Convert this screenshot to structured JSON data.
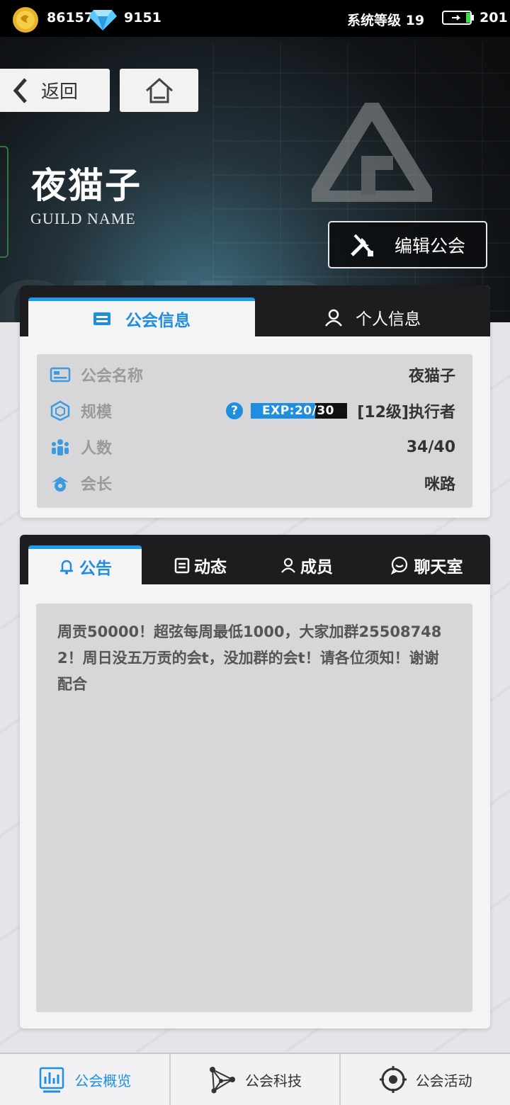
{
  "status": {
    "coins": "86157",
    "gems": "9151",
    "system_level": "系统等级 19",
    "battery": "201"
  },
  "top": {
    "back_label": "返回"
  },
  "guild": {
    "name": "夜猫子",
    "subtitle": "GUILD NAME",
    "edit_label": "编辑公会",
    "watermark": "GUILD"
  },
  "info_tabs": [
    {
      "label": "公会信息",
      "active": true
    },
    {
      "label": "个人信息",
      "active": false
    }
  ],
  "info_rows": {
    "name": {
      "label": "公会名称",
      "value": "夜猫子"
    },
    "scale": {
      "label": "规模",
      "value": "[12级]执行者",
      "exp_label": "EXP:20/30",
      "exp_current": 20,
      "exp_max": 30
    },
    "members": {
      "label": "人数",
      "value": "34/40"
    },
    "leader": {
      "label": "会长",
      "value": "咪路"
    }
  },
  "notice_tabs": [
    {
      "label": "公告",
      "icon": "bell-icon",
      "active": true
    },
    {
      "label": "动态",
      "icon": "clipboard-icon",
      "active": false
    },
    {
      "label": "成员",
      "icon": "person-icon",
      "active": false
    },
    {
      "label": "聊天室",
      "icon": "chat-icon",
      "active": false
    }
  ],
  "notice": {
    "text": "周贡50000！超弦每周最低1000，大家加群255087482！周日没五万贡的会t，没加群的会t！请各位须知！谢谢配合"
  },
  "bottom_nav": [
    {
      "label": "公会概览",
      "icon": "chart-icon",
      "active": true
    },
    {
      "label": "公会科技",
      "icon": "network-icon",
      "active": false
    },
    {
      "label": "公会活动",
      "icon": "target-icon",
      "active": false
    }
  ],
  "colors": {
    "accent": "#1e8fe0",
    "tabbar": "#1d1d1f",
    "panel": "#d7d7d9"
  }
}
